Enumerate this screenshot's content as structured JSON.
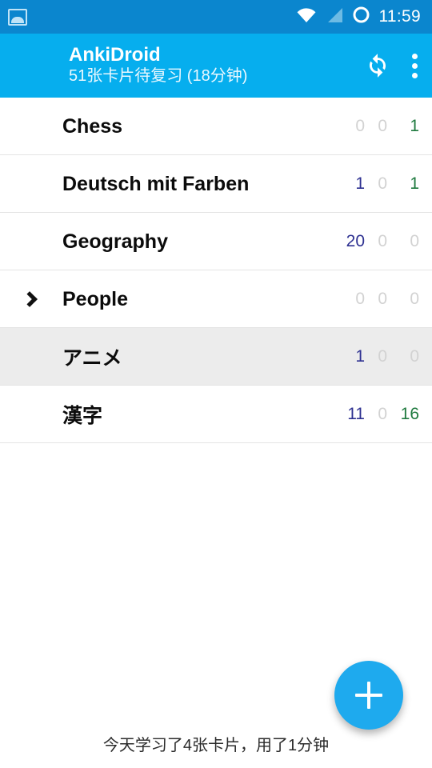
{
  "statusbar": {
    "notification_icon": "photo-icon",
    "wifi_icon": "wifi-icon",
    "signal_icon": "cell-signal-icon",
    "battery_icon": "battery-circle-icon",
    "time": "11:59"
  },
  "appbar": {
    "menu_icon": "hamburger-menu-icon",
    "title": "AnkiDroid",
    "subtitle": "51张卡片待复习 (18分钟)",
    "sync_icon": "sync-icon",
    "overflow_icon": "overflow-menu-icon",
    "background": "#06aeee"
  },
  "colors": {
    "status_bar": "#0b86ce",
    "app_bar": "#06aeee",
    "accent": "#1eaaee",
    "new_count": "#2e3191",
    "learn_count": "#cfcfcf",
    "review_count": "#1f7a3f",
    "zero_count": "#d2d2d2",
    "row_selected": "#ececec"
  },
  "decks": [
    {
      "name": "Chess",
      "new": "0",
      "learn": "0",
      "review": "1",
      "expandable": false,
      "selected": false
    },
    {
      "name": "Deutsch mit Farben",
      "new": "1",
      "learn": "0",
      "review": "1",
      "expandable": false,
      "selected": false
    },
    {
      "name": "Geography",
      "new": "20",
      "learn": "0",
      "review": "0",
      "expandable": false,
      "selected": false
    },
    {
      "name": "People",
      "new": "0",
      "learn": "0",
      "review": "0",
      "expandable": true,
      "selected": false
    },
    {
      "name": "アニメ",
      "new": "1",
      "learn": "0",
      "review": "0",
      "expandable": false,
      "selected": true
    },
    {
      "name": "漢字",
      "new": "11",
      "learn": "0",
      "review": "16",
      "expandable": false,
      "selected": false
    }
  ],
  "fab": {
    "icon": "plus-icon",
    "label": "+"
  },
  "bottom_status": {
    "text": "今天学习了4张卡片，用了1分钟"
  }
}
